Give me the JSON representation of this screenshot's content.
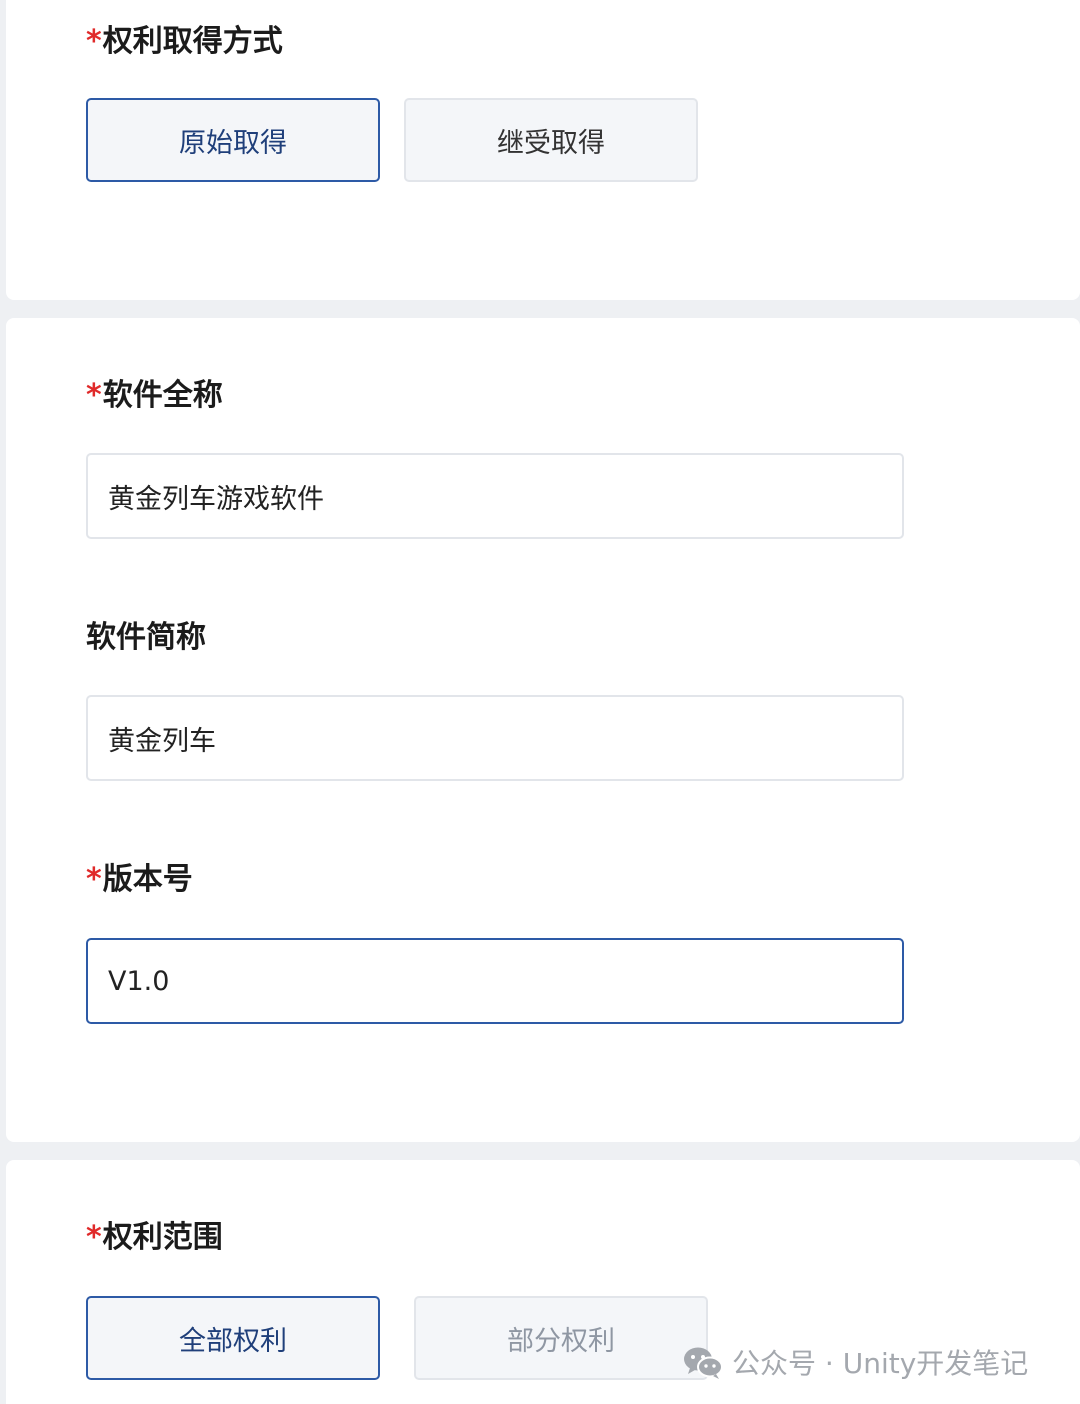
{
  "required_mark": "*",
  "rights_acquisition": {
    "label": "权利取得方式",
    "options": [
      {
        "label": "原始取得",
        "state": "selected"
      },
      {
        "label": "继受取得",
        "state": "unselected"
      }
    ]
  },
  "software": {
    "full_name": {
      "label": "软件全称",
      "value": "黄金列车游戏软件"
    },
    "short_name": {
      "label": "软件简称",
      "value": "黄金列车"
    },
    "version": {
      "label": "版本号",
      "value": "V1.0"
    }
  },
  "rights_scope": {
    "label": "权利范围",
    "options": [
      {
        "label": "全部权利",
        "state": "selected"
      },
      {
        "label": "部分权利",
        "state": "disabled"
      }
    ]
  },
  "watermark": {
    "text": "公众号 · Unity开发笔记",
    "icon": "wechat-icon"
  },
  "colors": {
    "accent": "#2d5aa6",
    "required": "#e02a2a",
    "background": "#eef0f3"
  }
}
